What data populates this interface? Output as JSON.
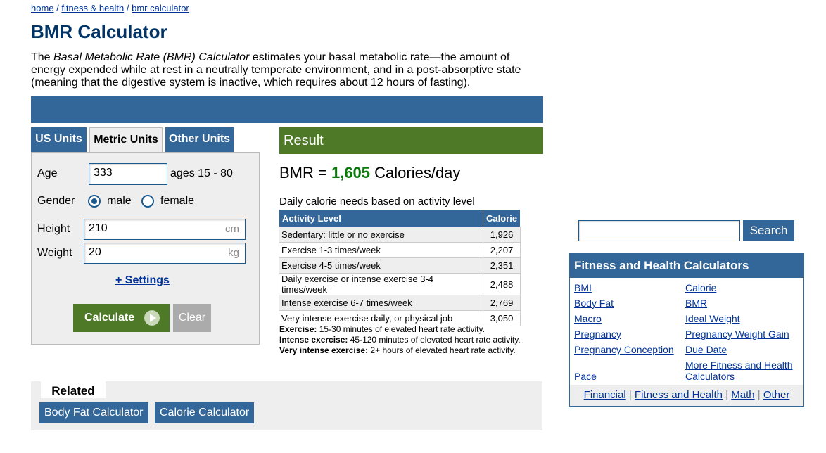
{
  "breadcrumb": {
    "home": "home",
    "section": "fitness & health",
    "page": "bmr calculator",
    "sep": " / "
  },
  "page_title": "BMR Calculator",
  "intro": {
    "pre": "The ",
    "em": "Basal Metabolic Rate (BMR) Calculator",
    "post": " estimates your basal metabolic rate—the amount of energy expended while at rest in a neutrally temperate environment, and in a post-absorptive state (meaning that the digestive system is inactive, which requires about 12 hours of fasting)."
  },
  "tabs": {
    "us": "US Units",
    "metric": "Metric Units",
    "other": "Other Units"
  },
  "form": {
    "age_label": "Age",
    "age_value": "333",
    "age_hint": "ages 15 - 80",
    "gender_label": "Gender",
    "male": "male",
    "female": "female",
    "height_label": "Height",
    "height_value": "210",
    "height_unit": "cm",
    "weight_label": "Weight",
    "weight_value": "20",
    "weight_unit": "kg",
    "settings": "+ Settings",
    "calculate": "Calculate",
    "clear": "Clear"
  },
  "result": {
    "header": "Result",
    "bmr_prefix": "BMR = ",
    "bmr_value": "1,605",
    "bmr_suffix": " Calories/day",
    "daily_title": "Daily calorie needs based on activity level",
    "table": {
      "headers": [
        "Activity Level",
        "Calorie"
      ],
      "rows": [
        [
          "Sedentary: little or no exercise",
          "1,926"
        ],
        [
          "Exercise 1-3 times/week",
          "2,207"
        ],
        [
          "Exercise 4-5 times/week",
          "2,351"
        ],
        [
          "Daily exercise or intense exercise 3-4 times/week",
          "2,488"
        ],
        [
          "Intense exercise 6-7 times/week",
          "2,769"
        ],
        [
          "Very intense exercise daily, or physical job",
          "3,050"
        ]
      ]
    },
    "notes": [
      {
        "term": "Exercise:",
        "text": " 15-30 minutes of elevated heart rate activity."
      },
      {
        "term": "Intense exercise:",
        "text": " 45-120 minutes of elevated heart rate activity."
      },
      {
        "term": "Very intense exercise:",
        "text": " 2+ hours of elevated heart rate activity."
      }
    ]
  },
  "related": {
    "title": "Related",
    "links": [
      "Body Fat Calculator",
      "Calorie Calculator"
    ]
  },
  "search": {
    "placeholder": "",
    "button": "Search"
  },
  "sidebar": {
    "title": "Fitness and Health Calculators",
    "links": [
      "BMI",
      "Calorie",
      "Body Fat",
      "BMR",
      "Macro",
      "Ideal Weight",
      "Pregnancy",
      "Pregnancy Weight Gain",
      "Pregnancy Conception",
      "Due Date",
      "Pace",
      "More Fitness and Health Calculators"
    ],
    "footer": [
      "Financial",
      "Fitness and Health",
      "Math",
      "Other"
    ],
    "footer_sep": " | "
  },
  "colors": {
    "brand_blue": "#336699",
    "result_green": "#4e7a27",
    "value_green": "#0a7a0a"
  }
}
